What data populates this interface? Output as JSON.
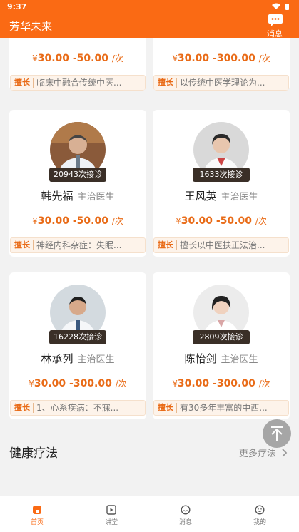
{
  "status": {
    "time": "9:37"
  },
  "appbar": {
    "title": "芳华未来",
    "message_label": "消息"
  },
  "doctors_top": [
    {
      "price": "30.00 -50.00",
      "specialty_tag": "擅长",
      "specialty": "临床中融合传统中医..."
    },
    {
      "price": "30.00 -300.00",
      "specialty_tag": "擅长",
      "specialty": "以传统中医学理论为..."
    }
  ],
  "doctors": [
    {
      "consult_count": "20943次接诊",
      "name": "韩先福",
      "title": "主治医生",
      "price": "30.00 -50.00",
      "price_unit": "/次",
      "specialty_tag": "擅长",
      "specialty": "神经内科杂症：失眠..."
    },
    {
      "consult_count": "1633次接诊",
      "name": "王风英",
      "title": "主治医生",
      "price": "30.00 -50.00",
      "price_unit": "/次",
      "specialty_tag": "擅长",
      "specialty": "擅长以中医扶正法治..."
    },
    {
      "consult_count": "16228次接诊",
      "name": "林承列",
      "title": "主治医生",
      "price": "30.00 -300.00",
      "price_unit": "/次",
      "specialty_tag": "擅长",
      "specialty": "1、心系疾病：不寐..."
    },
    {
      "consult_count": "2809次接诊",
      "name": "陈怡剑",
      "title": "主治医生",
      "price": "30.00 -300.00",
      "price_unit": "/次",
      "specialty_tag": "擅长",
      "specialty": "有30多年丰富的中西..."
    }
  ],
  "currency": "¥",
  "price_unit": "/次",
  "section": {
    "title": "健康疗法",
    "more": "更多疗法"
  },
  "tabbar": [
    {
      "label": "首页",
      "icon": "home-icon",
      "active": true
    },
    {
      "label": "讲堂",
      "icon": "play-icon",
      "active": false
    },
    {
      "label": "消息",
      "icon": "chat-icon",
      "active": false
    },
    {
      "label": "我的",
      "icon": "smile-icon",
      "active": false
    }
  ],
  "colors": {
    "brand": "#fa6a14",
    "price": "#e96b17",
    "badge_bg": "#3a2f27"
  }
}
